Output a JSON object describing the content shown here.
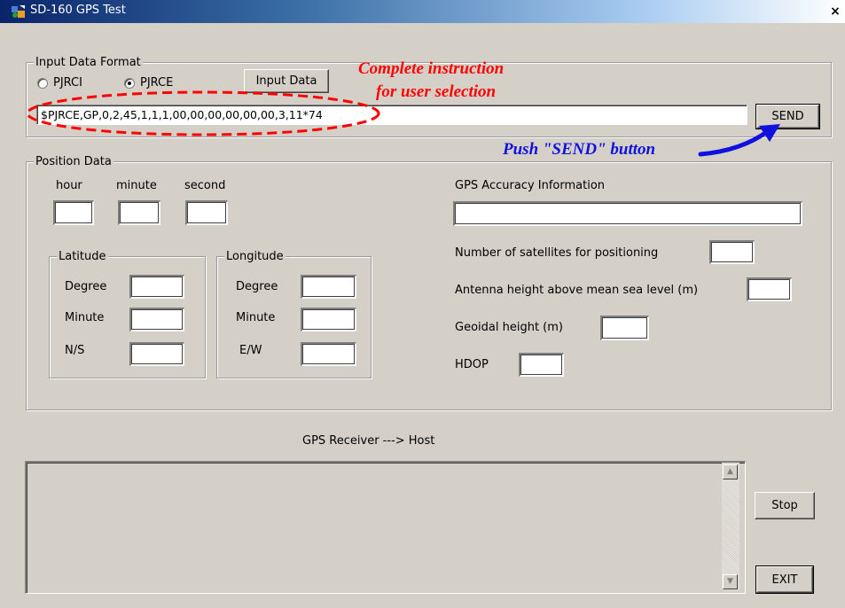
{
  "window": {
    "title": "SD-160 GPS Test",
    "close_glyph": "×"
  },
  "input_format": {
    "legend": "Input Data Format",
    "radio_pjrci": {
      "label": "PJRCI",
      "checked": false
    },
    "radio_pjrce": {
      "label": "PJRCE",
      "checked": true
    },
    "input_data_button": "Input Data",
    "command_value": "$PJRCE,GP,0,2,45,1,1,1,00,00,00,00,00,00,3,11*74",
    "send_button": "SEND"
  },
  "annotations": {
    "instruction_line1": "Complete instruction",
    "instruction_line2": "for user selection",
    "push_send": "Push \"SEND\" button",
    "red_color": "#ff0000",
    "blue_color": "#1010e0"
  },
  "position": {
    "legend": "Position Data",
    "hour_label": "hour",
    "minute_label": "minute",
    "second_label": "second",
    "latitude": {
      "legend": "Latitude",
      "degree_label": "Degree",
      "minute_label": "Minute",
      "ns_label": "N/S"
    },
    "longitude": {
      "legend": "Longitude",
      "degree_label": "Degree",
      "minute_label": "Minute",
      "ew_label": "E/W"
    },
    "accuracy_label": "GPS Accuracy Information",
    "satellites_label": "Number of satellites for positioning",
    "antenna_label": "Antenna height above mean sea level (m)",
    "geoidal_label": "Geoidal height (m)",
    "hdop_label": "HDOP"
  },
  "receiver": {
    "label": "GPS Receiver ---> Host",
    "stop_button": "Stop",
    "exit_button": "EXIT"
  }
}
